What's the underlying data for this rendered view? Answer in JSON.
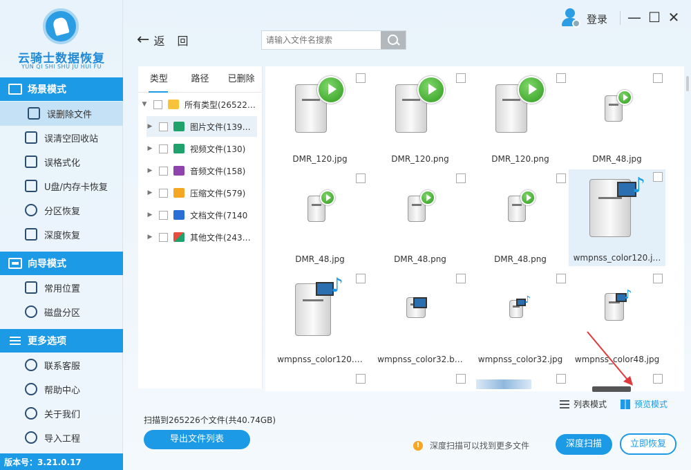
{
  "app": {
    "name": "云骑士数据恢复",
    "name_pinyin": "YUN QI SHI SHU JU HUI FU",
    "version": "版本号：3.21.0.17"
  },
  "sidebar": {
    "sections": [
      {
        "title": "场景模式",
        "items": [
          {
            "label": "误删除文件",
            "active": true
          },
          {
            "label": "误清空回收站"
          },
          {
            "label": "误格式化"
          },
          {
            "label": "U盘/内存卡恢复"
          },
          {
            "label": "分区恢复"
          },
          {
            "label": "深度恢复"
          }
        ]
      },
      {
        "title": "向导模式",
        "items": [
          {
            "label": "常用位置"
          },
          {
            "label": "磁盘分区"
          }
        ]
      },
      {
        "title": "更多选项",
        "items": [
          {
            "label": "联系客服"
          },
          {
            "label": "帮助中心"
          },
          {
            "label": "关于我们"
          },
          {
            "label": "导入工程"
          }
        ]
      }
    ]
  },
  "topbar": {
    "login": "登录",
    "minimize": "—",
    "maximize": "☐",
    "close": "✕",
    "back": "返",
    "back2": "回"
  },
  "search": {
    "placeholder": "请输入文件名搜索"
  },
  "tree": {
    "tabs": [
      "类型",
      "路径",
      "已删除"
    ],
    "root": {
      "label": "所有类型(26522…"
    },
    "items": [
      {
        "label": "图片文件(139…",
        "icon": "image-icon",
        "color": "#1fa26b"
      },
      {
        "label": "视频文件(130)",
        "icon": "video-icon",
        "color": "#1fa26b"
      },
      {
        "label": "音频文件(158)",
        "icon": "audio-icon",
        "color": "#8e44ad"
      },
      {
        "label": "压缩文件(579)",
        "icon": "archive-icon",
        "color": "#f5a623"
      },
      {
        "label": "文档文件(7140",
        "icon": "document-icon",
        "color": "#2a6fd6"
      },
      {
        "label": "其他文件(243…",
        "icon": "other-icon",
        "color": "#e74c3c"
      }
    ]
  },
  "files": [
    {
      "name": "DMR_120.jpg"
    },
    {
      "name": "DMR_120.png"
    },
    {
      "name": "DMR_120.png"
    },
    {
      "name": "DMR_48.jpg"
    },
    {
      "name": "DMR_48.jpg"
    },
    {
      "name": "DMR_48.png"
    },
    {
      "name": "DMR_48.png"
    },
    {
      "name": "wmpnss_color120.j…"
    },
    {
      "name": "wmpnss_color120.…"
    },
    {
      "name": "wmpnss_color32.b…"
    },
    {
      "name": "wmpnss_color32.jpg"
    },
    {
      "name": "wmpnss_color48.jpg"
    }
  ],
  "footer": {
    "list_mode": "列表模式",
    "preview_mode": "预览模式",
    "scan_info": "扫描到265226个文件(共40.74GB)",
    "export_btn": "导出文件列表",
    "hint": "深度扫描可以找到更多文件",
    "deep_scan": "深度扫描",
    "recover_now": "立即恢复"
  },
  "colors": {
    "accent": "#1d9ae6",
    "play_green": "#2f9b1e",
    "annotation_arrow": "#e0393b"
  }
}
